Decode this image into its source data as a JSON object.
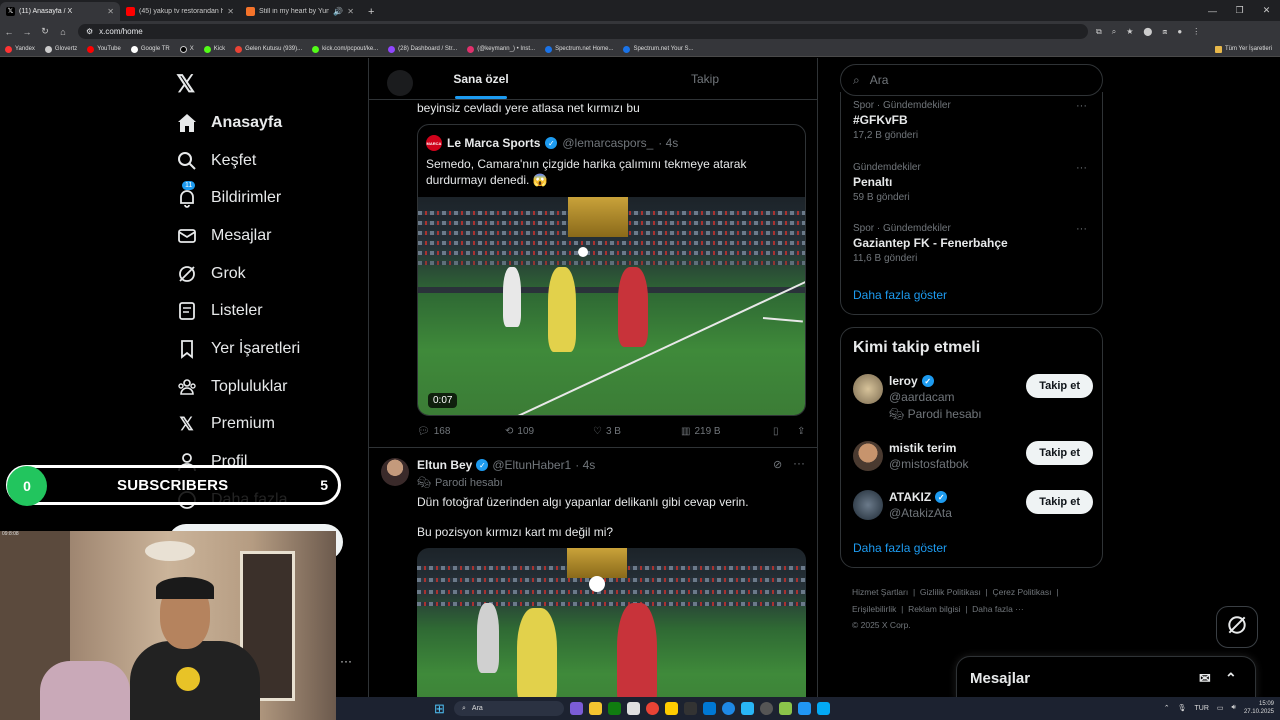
{
  "browser": {
    "tabs": [
      {
        "title": "(11) Anasayfa / X",
        "active": true,
        "color": "#000000"
      },
      {
        "title": "(45) yakup tv restorandan hesa",
        "active": false,
        "color": "#ff0000"
      },
      {
        "title": "Still in my heart by Yung N",
        "active": false,
        "color": "#f5732a"
      }
    ],
    "url": "x.com/home",
    "bookmarks": [
      "Yandex",
      "Glovertz",
      "YouTube",
      "Google TR",
      "X",
      "Kick",
      "Gelen Kutusu (939)...",
      "kick.com/pcpout/ke...",
      "(28) Dashboard / Str...",
      "(@keymann_) • Inst...",
      "Spectrum.net Home...",
      "Spectrum.net Your S..."
    ],
    "bookmarks_right": "Tüm Yer İşaretleri"
  },
  "nav": {
    "items": [
      {
        "label": "Anasayfa",
        "icon": "home-icon"
      },
      {
        "label": "Keşfet",
        "icon": "search-icon"
      },
      {
        "label": "Bildirimler",
        "icon": "bell-icon",
        "badge": "11"
      },
      {
        "label": "Mesajlar",
        "icon": "mail-icon"
      },
      {
        "label": "Grok",
        "icon": "grok-icon"
      },
      {
        "label": "Listeler",
        "icon": "list-icon"
      },
      {
        "label": "Yer İşaretleri",
        "icon": "bookmark-icon"
      },
      {
        "label": "Topluluklar",
        "icon": "communities-icon"
      },
      {
        "label": "Premium",
        "icon": "x-icon"
      },
      {
        "label": "Profil",
        "icon": "profile-icon"
      },
      {
        "label": "Daha fazla",
        "icon": "more-icon"
      }
    ]
  },
  "feed": {
    "tabs": [
      "Sana özel",
      "Takip"
    ],
    "post1": {
      "text_tail": "beyinsiz cevladı yere atlasa net kırmızı bu",
      "quote": {
        "name": "Le Marca Sports",
        "handle": "@lemarcaspors_",
        "time": "· 4s",
        "text": "Semedo, Camara'nın çizgide harika çalımını tekmeye atarak durdurmayı denedi. 😱",
        "video_duration": "0:07"
      },
      "stats": {
        "replies": "168",
        "reposts": "109",
        "likes": "3 B",
        "views": "219 B"
      }
    },
    "post2": {
      "name": "Eltun Bey",
      "handle": "@EltunHaber1",
      "time": "· 4s",
      "label": "Parodi hesabı",
      "text1": "Dün fotoğraf üzerinden algı yapanlar delikanlı gibi cevap verin.",
      "text2": "Bu pozisyon kırmızı kart mı değil mi?"
    }
  },
  "right": {
    "search_placeholder": "Ara",
    "trends": [
      {
        "category": "Spor · Gündemdekiler",
        "name": "#GFKvFB",
        "count": "17,2 B gönderi"
      },
      {
        "category": "Gündemdekiler",
        "name": "Penaltı",
        "count": "59 B gönderi"
      },
      {
        "category": "Spor · Gündemdekiler",
        "name": "Gaziantep FK - Fenerbahçe",
        "count": "11,6 B gönderi"
      }
    ],
    "show_more": "Daha fazla göster",
    "follow_title": "Kimi takip etmeli",
    "follow": [
      {
        "name": "leroy",
        "handle": "@aardacam",
        "extra": "Parodi hesabı",
        "verified": true
      },
      {
        "name": "mistik terim",
        "handle": "@mistosfatbok",
        "extra": "",
        "verified": false
      },
      {
        "name": "ATAKIZ",
        "handle": "@AtakizAta",
        "extra": "",
        "verified": true
      }
    ],
    "follow_button": "Takip et",
    "footer": [
      "Hizmet Şartları",
      "Gizlilik Politikası",
      "Çerez Politikası",
      "Erişilebilirlik",
      "Reklam bilgisi",
      "Daha fazla ···",
      "© 2025 X Corp."
    ],
    "messages_label": "Mesajlar"
  },
  "overlay": {
    "subscribers_label": "SUBSCRIBERS",
    "left_count": "0",
    "right_count": "5",
    "cam_timestamp": "09:8:08"
  },
  "taskbar": {
    "search": "Ara",
    "lang": "TUR",
    "time": "15:09",
    "date": "27.10.2025"
  }
}
